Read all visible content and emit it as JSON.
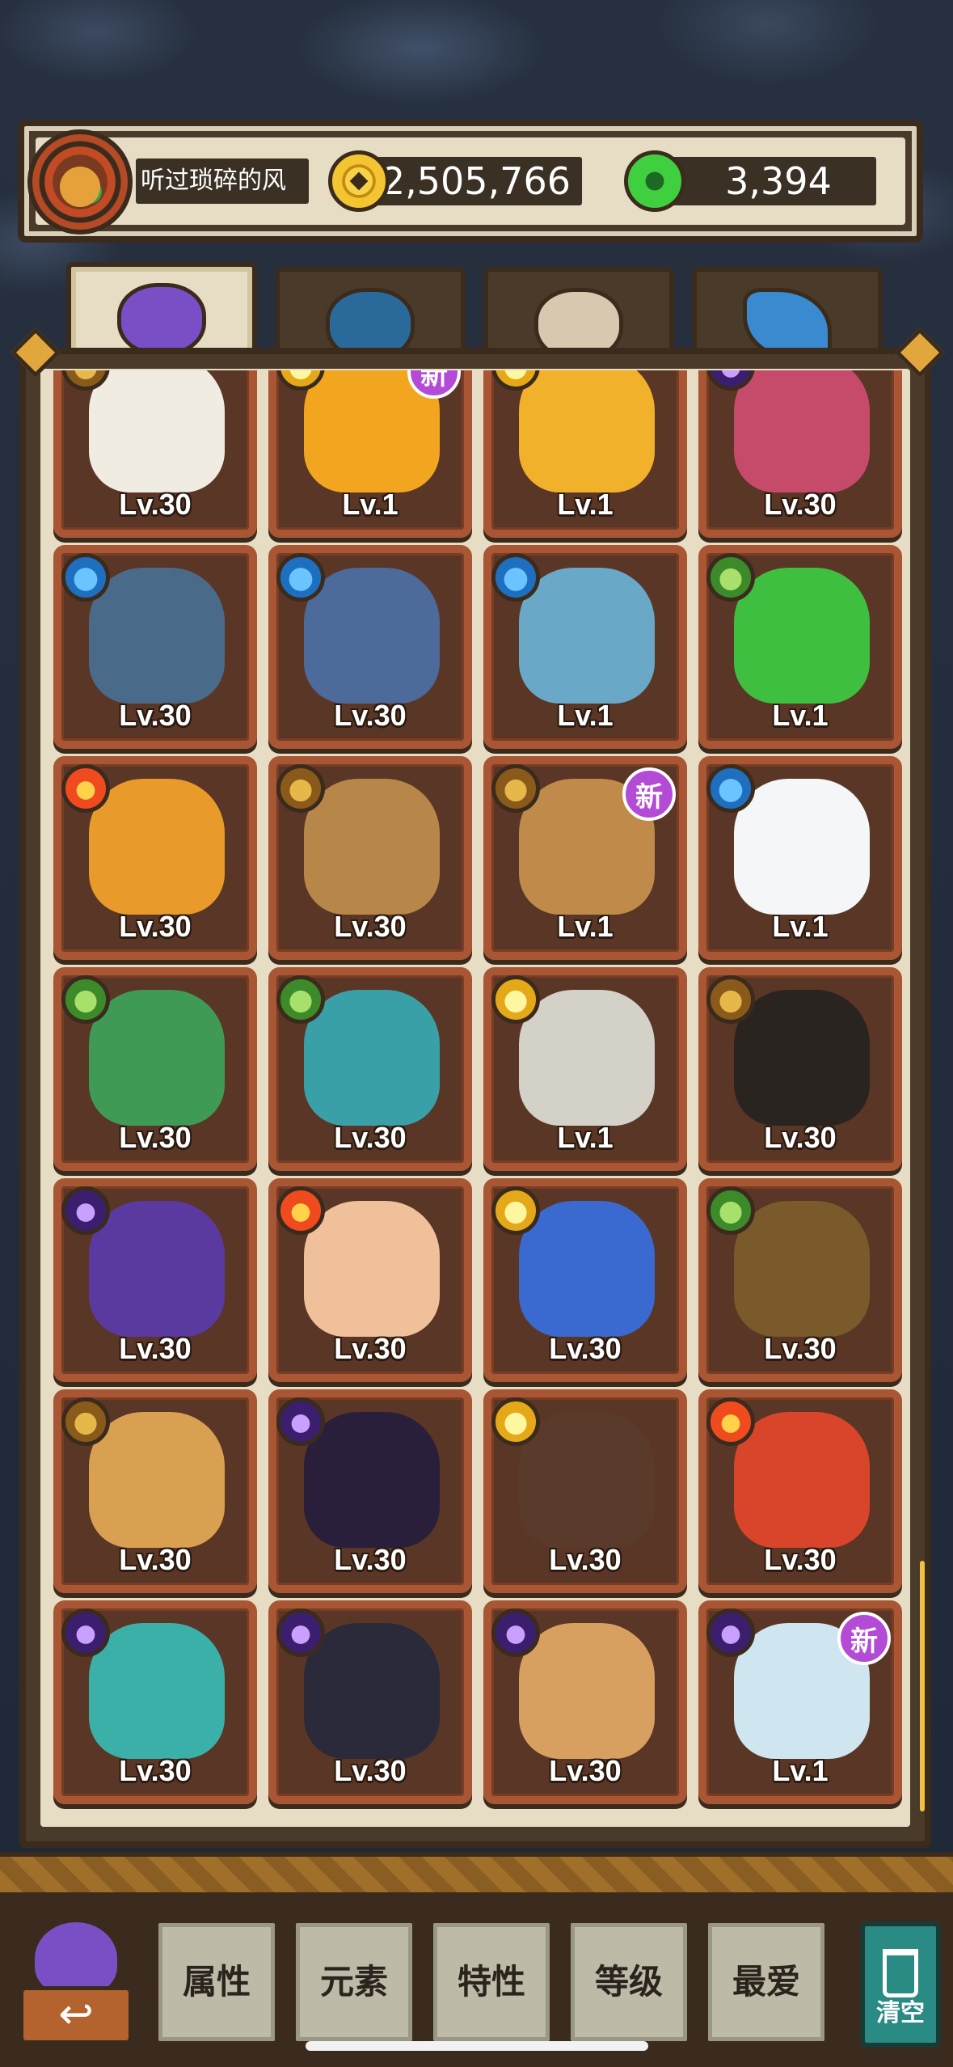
{
  "player": {
    "name": "听过琐碎的风",
    "coins": "2,505,766",
    "gems": "3,394"
  },
  "tabs": [
    {
      "name": "monsters",
      "icon": "purple-monster-icon",
      "active": true
    },
    {
      "name": "items",
      "icon": "peacock-feather-icon",
      "active": false
    },
    {
      "name": "food",
      "icon": "ramen-bowl-icon",
      "active": false
    },
    {
      "name": "crystals",
      "icon": "blue-crystal-icon",
      "active": false
    }
  ],
  "cards": [
    {
      "level": "Lv.30",
      "element": "earth",
      "new": false,
      "art": "#f0ece2",
      "art_name": "bun-duo"
    },
    {
      "level": "Lv.1",
      "element": "light",
      "new": true,
      "art": "#f2a61f",
      "art_name": "gold-coin"
    },
    {
      "level": "Lv.1",
      "element": "light",
      "new": false,
      "art": "#f2b12a",
      "art_name": "golden-cat"
    },
    {
      "level": "Lv.30",
      "element": "dark",
      "new": false,
      "art": "#c64a6a",
      "art_name": "pink-drum"
    },
    {
      "level": "Lv.30",
      "element": "water",
      "new": false,
      "art": "#4a6a8a",
      "art_name": "straw-hat-fisher"
    },
    {
      "level": "Lv.30",
      "element": "water",
      "new": false,
      "art": "#4c6a9a",
      "art_name": "teapot-elephant"
    },
    {
      "level": "Lv.1",
      "element": "water",
      "new": false,
      "art": "#6aa8c8",
      "art_name": "pearl-clam"
    },
    {
      "level": "Lv.1",
      "element": "wood",
      "new": false,
      "art": "#3fbf3f",
      "art_name": "green-horn"
    },
    {
      "level": "Lv.30",
      "element": "fire",
      "new": false,
      "art": "#e89a2a",
      "art_name": "lantern-lion"
    },
    {
      "level": "Lv.30",
      "element": "earth",
      "new": false,
      "art": "#b7874a",
      "art_name": "stone-monkey"
    },
    {
      "level": "Lv.1",
      "element": "earth",
      "new": true,
      "art": "#c08a4a",
      "art_name": "wood-mouse"
    },
    {
      "level": "Lv.1",
      "element": "water",
      "new": false,
      "art": "#f4f6f8",
      "art_name": "snowball"
    },
    {
      "level": "Lv.30",
      "element": "wood",
      "new": false,
      "art": "#3f9a55",
      "art_name": "green-general"
    },
    {
      "level": "Lv.30",
      "element": "wood",
      "new": false,
      "art": "#3aa0a8",
      "art_name": "blue-opera"
    },
    {
      "level": "Lv.1",
      "element": "light",
      "new": false,
      "art": "#d4d2c8",
      "art_name": "stone-tablet"
    },
    {
      "level": "Lv.30",
      "element": "earth",
      "new": false,
      "art": "#2a2420",
      "art_name": "black-constable"
    },
    {
      "level": "Lv.30",
      "element": "dark",
      "new": false,
      "art": "#5a3aa0",
      "art_name": "jiangshi"
    },
    {
      "level": "Lv.30",
      "element": "fire",
      "new": false,
      "art": "#f0c09a",
      "art_name": "bald-monk"
    },
    {
      "level": "Lv.30",
      "element": "light",
      "new": false,
      "art": "#3a6ad0",
      "art_name": "blue-hair-girl"
    },
    {
      "level": "Lv.30",
      "element": "wood",
      "new": false,
      "art": "#7a5a2a",
      "art_name": "spider-hat"
    },
    {
      "level": "Lv.30",
      "element": "earth",
      "new": false,
      "art": "#d8a050",
      "art_name": "old-sage"
    },
    {
      "level": "Lv.30",
      "element": "dark",
      "new": false,
      "art": "#2a1f3a",
      "art_name": "veiled-lady"
    },
    {
      "level": "Lv.30",
      "element": "light",
      "new": false,
      "art": "#5a3a2a",
      "art_name": "ox-horn-girl"
    },
    {
      "level": "Lv.30",
      "element": "fire",
      "new": false,
      "art": "#d8452a",
      "art_name": "red-house"
    },
    {
      "level": "Lv.30",
      "element": "dark",
      "new": false,
      "art": "#3ab0a8",
      "art_name": "teal-ghost"
    },
    {
      "level": "Lv.30",
      "element": "dark",
      "new": false,
      "art": "#2a2a3a",
      "art_name": "spiked-bomb"
    },
    {
      "level": "Lv.30",
      "element": "dark",
      "new": false,
      "art": "#d8a060",
      "art_name": "frog-fan"
    },
    {
      "level": "Lv.1",
      "element": "dark",
      "new": true,
      "art": "#cfe6f0",
      "art_name": "pale-fish"
    }
  ],
  "new_badge": "新",
  "toolbar": {
    "back_icon": "↩",
    "buttons": [
      "属性",
      "元素",
      "特性",
      "等级",
      "最爱"
    ],
    "clear": "清空"
  },
  "colors": {
    "card_border": "#a85634",
    "card_bg": "#5a3626",
    "panel": "#e7ddc4"
  }
}
